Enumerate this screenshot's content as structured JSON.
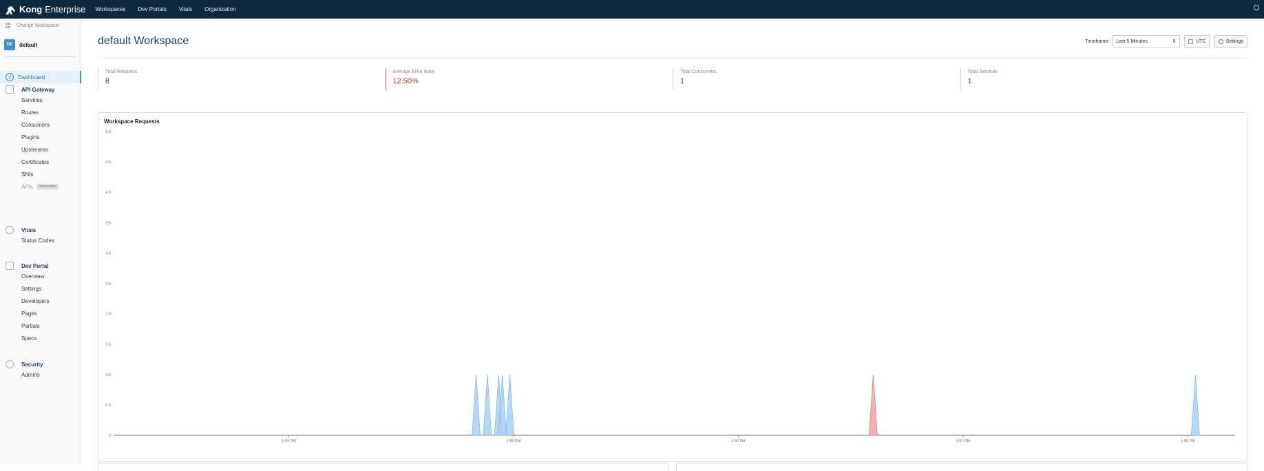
{
  "topbar": {
    "brand": "Kong",
    "edition": "Enterprise",
    "nav": [
      "Workspaces",
      "Dev Portals",
      "Vitals",
      "Organization"
    ]
  },
  "sidebar": {
    "change_workspace": "Change Workspace",
    "workspace_badge": "DE",
    "workspace_name": "default",
    "dashboard": "Dashboard",
    "sections": [
      {
        "title": "API Gateway",
        "items": [
          "Services",
          "Routes",
          "Consumers",
          "Plugins",
          "Upstreams",
          "Certificates",
          "SNIs",
          "APIs"
        ]
      },
      {
        "title": "Vitals",
        "items": [
          "Status Codes"
        ]
      },
      {
        "title": "Dev Portal",
        "items": [
          "Overview",
          "Settings",
          "Developers",
          "Pages",
          "Partials",
          "Specs"
        ]
      },
      {
        "title": "Security",
        "items": [
          "Admins"
        ]
      }
    ],
    "deprecated_label": "Deprecated"
  },
  "main": {
    "title": "default Workspace",
    "timeframe_label": "Timeframe:",
    "timeframe_value": "Last 5 Minutes",
    "utc_label": "UTC",
    "settings_label": "Settings",
    "stats": [
      {
        "label": "Total Requests",
        "value": "8"
      },
      {
        "label": "Average Error Rate",
        "value": "12.50%"
      },
      {
        "label": "Total Consumers",
        "value": "1"
      },
      {
        "label": "Total Services",
        "value": "1"
      }
    ],
    "chart_title": "Workspace Requests"
  },
  "colors": {
    "navy": "#0d2a42",
    "accent": "#3a8fd6",
    "success_fill": "#a9d1f3",
    "error_fill": "#f0a3a3"
  },
  "chart_data": {
    "type": "area",
    "title": "Workspace Requests",
    "ylim": [
      0,
      5
    ],
    "yticks": [
      "0",
      "0.5",
      "1.0",
      "1.5",
      "2.0",
      "2.5",
      "3.0",
      "3.5",
      "4.0",
      "4.5",
      "5.0"
    ],
    "xticks": [
      "1:54 PM",
      "1:55 PM",
      "1:56 PM",
      "1:57 PM",
      "1:58 PM"
    ],
    "series": [
      {
        "color": "#a9d1f3",
        "points": [
          {
            "x": "1:54:50",
            "y": 1
          },
          {
            "x": "1:54:53",
            "y": 1
          },
          {
            "x": "1:54:56",
            "y": 1
          },
          {
            "x": "1:54:57",
            "y": 1
          },
          {
            "x": "1:54:59",
            "y": 1
          },
          {
            "x": "1:58:02",
            "y": 1
          }
        ]
      },
      {
        "color": "#f0a3a3",
        "points": [
          {
            "x": "1:56:36",
            "y": 1
          }
        ]
      }
    ]
  }
}
